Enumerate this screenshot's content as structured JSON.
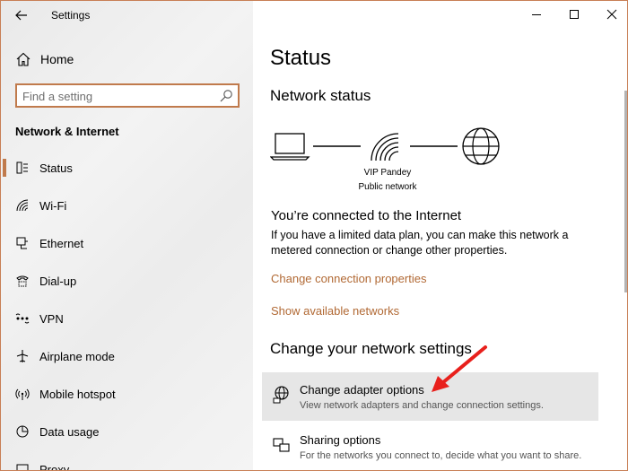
{
  "window": {
    "title": "Settings",
    "controls": [
      "minimize-icon",
      "maximize-icon",
      "close-icon"
    ]
  },
  "sidebar": {
    "home_label": "Home",
    "search_placeholder": "Find a setting",
    "section_heading": "Network & Internet",
    "selected": "Status",
    "items": [
      {
        "label": "Status",
        "icon": "status-icon"
      },
      {
        "label": "Wi-Fi",
        "icon": "wifi-icon"
      },
      {
        "label": "Ethernet",
        "icon": "ethernet-icon"
      },
      {
        "label": "Dial-up",
        "icon": "dialup-icon"
      },
      {
        "label": "VPN",
        "icon": "vpn-icon"
      },
      {
        "label": "Airplane mode",
        "icon": "airplane-icon"
      },
      {
        "label": "Mobile hotspot",
        "icon": "hotspot-icon"
      },
      {
        "label": "Data usage",
        "icon": "data-usage-icon"
      },
      {
        "label": "Proxy",
        "icon": "proxy-icon"
      }
    ]
  },
  "main": {
    "title": "Status",
    "network_status_heading": "Network status",
    "network_name": "VIP Pandey",
    "network_type": "Public network",
    "connected_heading": "You’re connected to the Internet",
    "connected_desc": "If you have a limited data plan, you can make this network a metered connection or change other properties.",
    "links": {
      "change_connection": "Change connection properties",
      "show_networks": "Show available networks"
    },
    "change_heading": "Change your network settings",
    "options": [
      {
        "title": "Change adapter options",
        "subtitle": "View network adapters and change connection settings.",
        "icon": "adapter-icon",
        "highlighted": true
      },
      {
        "title": "Sharing options",
        "subtitle": "For the networks you connect to, decide what you want to share.",
        "icon": "sharing-icon",
        "highlighted": false
      }
    ]
  },
  "colors": {
    "accent": "#c07a4c",
    "link": "#b16934",
    "highlight": "#e6e6e6",
    "annotation_arrow": "#e8201c"
  }
}
